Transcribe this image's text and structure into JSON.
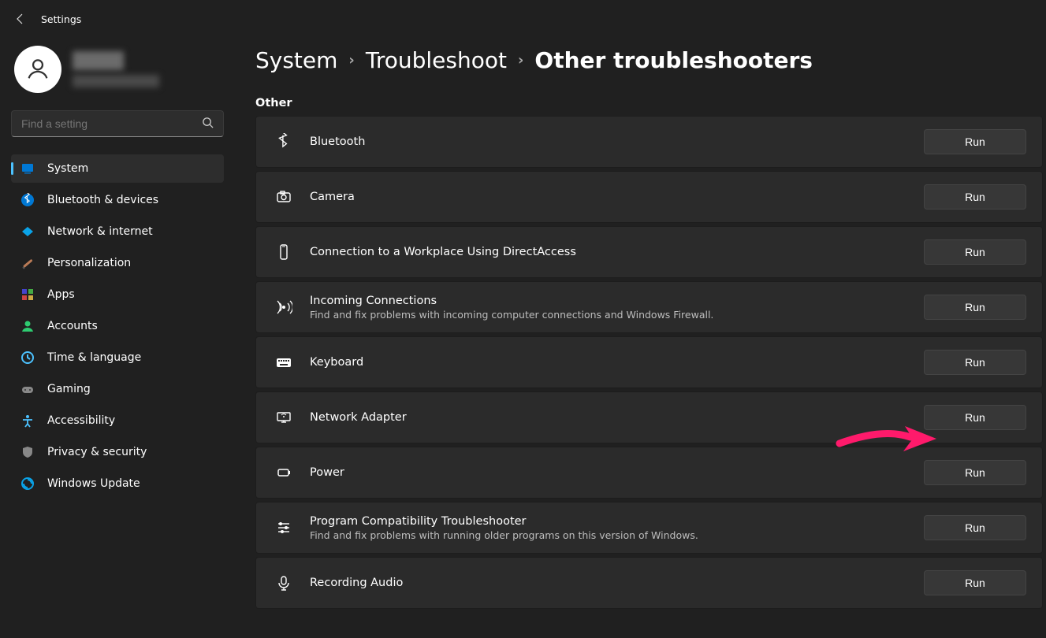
{
  "app_title": "Settings",
  "search": {
    "placeholder": "Find a setting"
  },
  "nav": [
    {
      "label": "System",
      "icon": "system",
      "active": true
    },
    {
      "label": "Bluetooth & devices",
      "icon": "bluetooth"
    },
    {
      "label": "Network & internet",
      "icon": "network"
    },
    {
      "label": "Personalization",
      "icon": "personalization"
    },
    {
      "label": "Apps",
      "icon": "apps"
    },
    {
      "label": "Accounts",
      "icon": "accounts"
    },
    {
      "label": "Time & language",
      "icon": "time"
    },
    {
      "label": "Gaming",
      "icon": "gaming"
    },
    {
      "label": "Accessibility",
      "icon": "accessibility"
    },
    {
      "label": "Privacy & security",
      "icon": "privacy"
    },
    {
      "label": "Windows Update",
      "icon": "update"
    }
  ],
  "breadcrumbs": {
    "level1": "System",
    "level2": "Troubleshoot",
    "level3": "Other troubleshooters"
  },
  "section_label": "Other",
  "run_label": "Run",
  "troubleshooters": [
    {
      "title": "Bluetooth",
      "icon": "bluetooth",
      "desc": ""
    },
    {
      "title": "Camera",
      "icon": "camera",
      "desc": ""
    },
    {
      "title": "Connection to a Workplace Using DirectAccess",
      "icon": "phone",
      "desc": ""
    },
    {
      "title": "Incoming Connections",
      "icon": "signal",
      "desc": "Find and fix problems with incoming computer connections and Windows Firewall."
    },
    {
      "title": "Keyboard",
      "icon": "keyboard",
      "desc": ""
    },
    {
      "title": "Network Adapter",
      "icon": "netadapter",
      "desc": ""
    },
    {
      "title": "Power",
      "icon": "power",
      "desc": ""
    },
    {
      "title": "Program Compatibility Troubleshooter",
      "icon": "compat",
      "desc": "Find and fix problems with running older programs on this version of Windows."
    },
    {
      "title": "Recording Audio",
      "icon": "mic",
      "desc": ""
    }
  ],
  "annotation_arrow_target_index": 5
}
